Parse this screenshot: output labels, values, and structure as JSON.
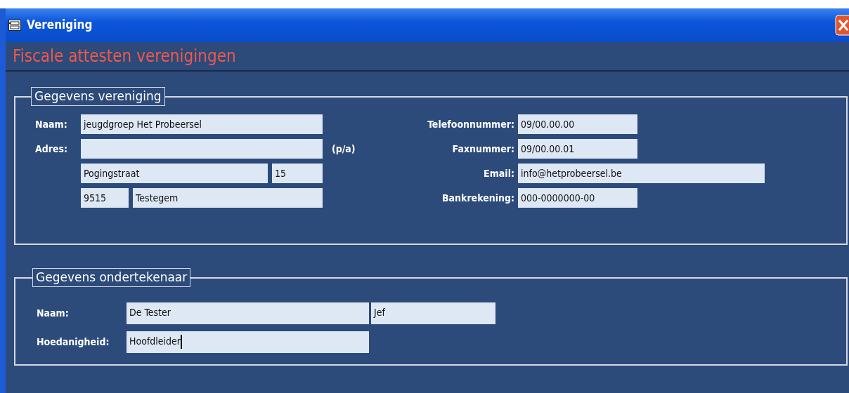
{
  "window": {
    "title": "Vereniging"
  },
  "header": {
    "title": "Fiscale attesten verenigingen"
  },
  "association": {
    "title": "Gegevens vereniging",
    "name": {
      "label": "Naam:",
      "value": "jeugdgroep Het Probeersel"
    },
    "address": {
      "label": "Adres:",
      "note": "(p/a)",
      "street": "Pogingstraat",
      "number": "15",
      "postal_code": "9515",
      "city": "Testegem"
    },
    "contacts": [
      {
        "label": "Telefoonnummer:",
        "value": "09/00.00.00",
        "kind": "short"
      },
      {
        "label": "Faxnummer:",
        "value": "09/00.00.01",
        "kind": "short"
      },
      {
        "label": "Email:",
        "value": "info@hetprobeersel.be",
        "kind": "long"
      },
      {
        "label": "Bankrekening:",
        "value": "000-0000000-00",
        "kind": "short"
      }
    ]
  },
  "signer": {
    "title": "Gegevens ondertekenaar",
    "name": {
      "label": "Naam:",
      "last_name": "De Tester",
      "first_name": "Jef"
    },
    "role": {
      "label": "Hoedanigheid:",
      "value": "Hoofdleider",
      "focused": true
    }
  }
}
